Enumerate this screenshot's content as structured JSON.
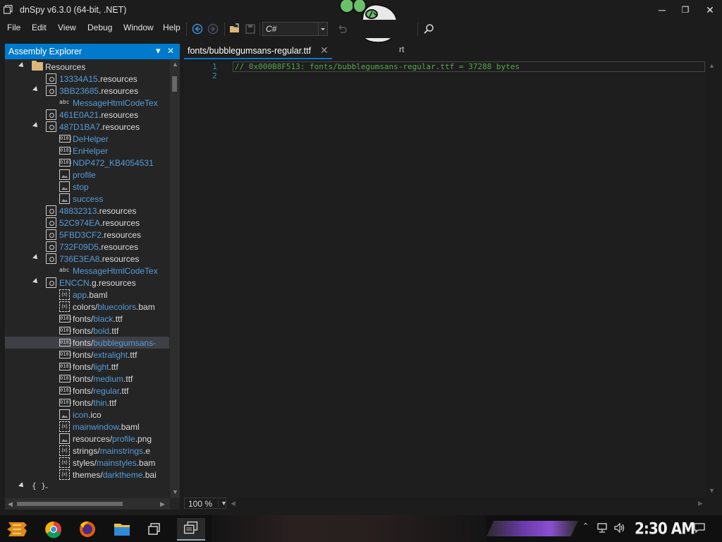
{
  "window": {
    "title": "dnSpy v6.3.0 (64-bit, .NET)",
    "minimize": "─",
    "restore": "❐",
    "close": "✕"
  },
  "menu": {
    "items": [
      "File",
      "Edit",
      "View",
      "Debug",
      "Window",
      "Help"
    ],
    "language": "C#",
    "start_fragment": "rt"
  },
  "explorer": {
    "title": "Assembly Explorer",
    "dropdown_glyph": "▾",
    "close_glyph": "✕",
    "rows": [
      {
        "indent": 0,
        "icon": "folder",
        "expander": true,
        "parts": [
          {
            "t": "Resources",
            "c": "white"
          }
        ]
      },
      {
        "indent": 1,
        "icon": "resource",
        "expander": false,
        "parts": [
          {
            "t": "13334A15",
            "c": "blue"
          },
          {
            "t": ".resources",
            "c": "white"
          }
        ]
      },
      {
        "indent": 1,
        "icon": "resource",
        "expander": true,
        "parts": [
          {
            "t": "3BB23685",
            "c": "blue"
          },
          {
            "t": ".resources",
            "c": "white"
          }
        ]
      },
      {
        "indent": 2,
        "icon": "abc",
        "expander": false,
        "parts": [
          {
            "t": "MessageHtmlCodeTex",
            "c": "blue"
          }
        ]
      },
      {
        "indent": 1,
        "icon": "resource",
        "expander": false,
        "parts": [
          {
            "t": "461E0A21",
            "c": "blue"
          },
          {
            "t": ".resources",
            "c": "white"
          }
        ]
      },
      {
        "indent": 1,
        "icon": "resource",
        "expander": true,
        "parts": [
          {
            "t": "487D1BA7",
            "c": "blue"
          },
          {
            "t": ".resources",
            "c": "white"
          }
        ]
      },
      {
        "indent": 2,
        "icon": "binary",
        "expander": false,
        "parts": [
          {
            "t": "DeHelper",
            "c": "blue"
          }
        ]
      },
      {
        "indent": 2,
        "icon": "binary",
        "expander": false,
        "parts": [
          {
            "t": "EnHelper",
            "c": "blue"
          }
        ]
      },
      {
        "indent": 2,
        "icon": "binary",
        "expander": false,
        "parts": [
          {
            "t": "NDP472_KB4054531",
            "c": "blue"
          }
        ]
      },
      {
        "indent": 2,
        "icon": "image",
        "expander": false,
        "parts": [
          {
            "t": "profile",
            "c": "blue"
          }
        ]
      },
      {
        "indent": 2,
        "icon": "image",
        "expander": false,
        "parts": [
          {
            "t": "stop",
            "c": "blue"
          }
        ]
      },
      {
        "indent": 2,
        "icon": "image",
        "expander": false,
        "parts": [
          {
            "t": "success",
            "c": "blue"
          }
        ]
      },
      {
        "indent": 1,
        "icon": "resource",
        "expander": false,
        "parts": [
          {
            "t": "48832313",
            "c": "blue"
          },
          {
            "t": ".resources",
            "c": "white"
          }
        ]
      },
      {
        "indent": 1,
        "icon": "resource",
        "expander": false,
        "parts": [
          {
            "t": "52C974EA",
            "c": "blue"
          },
          {
            "t": ".resources",
            "c": "white"
          }
        ]
      },
      {
        "indent": 1,
        "icon": "resource",
        "expander": false,
        "parts": [
          {
            "t": "5FBD3CF2",
            "c": "blue"
          },
          {
            "t": ".resources",
            "c": "white"
          }
        ]
      },
      {
        "indent": 1,
        "icon": "resource",
        "expander": false,
        "parts": [
          {
            "t": "732F09D5",
            "c": "blue"
          },
          {
            "t": ".resources",
            "c": "white"
          }
        ]
      },
      {
        "indent": 1,
        "icon": "resource",
        "expander": true,
        "parts": [
          {
            "t": "736E3EA8",
            "c": "blue"
          },
          {
            "t": ".resources",
            "c": "white"
          }
        ]
      },
      {
        "indent": 2,
        "icon": "abc",
        "expander": false,
        "parts": [
          {
            "t": "MessageHtmlCodeTex",
            "c": "blue"
          }
        ]
      },
      {
        "indent": 1,
        "icon": "resource",
        "expander": true,
        "parts": [
          {
            "t": "ENCCN",
            "c": "blue"
          },
          {
            "t": ".g.resources",
            "c": "white"
          }
        ]
      },
      {
        "indent": 2,
        "icon": "baml",
        "expander": false,
        "parts": [
          {
            "t": "app",
            "c": "blue"
          },
          {
            "t": ".baml",
            "c": "white"
          }
        ]
      },
      {
        "indent": 2,
        "icon": "baml",
        "expander": false,
        "parts": [
          {
            "t": "colors/",
            "c": "white"
          },
          {
            "t": "bluecolors",
            "c": "blue"
          },
          {
            "t": ".bam",
            "c": "white"
          }
        ]
      },
      {
        "indent": 2,
        "icon": "binary",
        "expander": false,
        "parts": [
          {
            "t": "fonts/",
            "c": "white"
          },
          {
            "t": "black",
            "c": "blue"
          },
          {
            "t": ".ttf",
            "c": "white"
          }
        ]
      },
      {
        "indent": 2,
        "icon": "binary",
        "expander": false,
        "parts": [
          {
            "t": "fonts/",
            "c": "white"
          },
          {
            "t": "bold",
            "c": "blue"
          },
          {
            "t": ".ttf",
            "c": "white"
          }
        ]
      },
      {
        "indent": 2,
        "icon": "binary",
        "expander": false,
        "selected": true,
        "parts": [
          {
            "t": "fonts/",
            "c": "white"
          },
          {
            "t": "bubblegumsans-",
            "c": "blue"
          }
        ]
      },
      {
        "indent": 2,
        "icon": "binary",
        "expander": false,
        "parts": [
          {
            "t": "fonts/",
            "c": "white"
          },
          {
            "t": "extralight",
            "c": "blue"
          },
          {
            "t": ".ttf",
            "c": "white"
          }
        ]
      },
      {
        "indent": 2,
        "icon": "binary",
        "expander": false,
        "parts": [
          {
            "t": "fonts/",
            "c": "white"
          },
          {
            "t": "light",
            "c": "blue"
          },
          {
            "t": ".ttf",
            "c": "white"
          }
        ]
      },
      {
        "indent": 2,
        "icon": "binary",
        "expander": false,
        "parts": [
          {
            "t": "fonts/",
            "c": "white"
          },
          {
            "t": "medium",
            "c": "blue"
          },
          {
            "t": ".ttf",
            "c": "white"
          }
        ]
      },
      {
        "indent": 2,
        "icon": "binary",
        "expander": false,
        "parts": [
          {
            "t": "fonts/",
            "c": "white"
          },
          {
            "t": "regular",
            "c": "blue"
          },
          {
            "t": ".ttf",
            "c": "white"
          }
        ]
      },
      {
        "indent": 2,
        "icon": "binary",
        "expander": false,
        "parts": [
          {
            "t": "fonts/",
            "c": "white"
          },
          {
            "t": "thin",
            "c": "blue"
          },
          {
            "t": ".ttf",
            "c": "white"
          }
        ]
      },
      {
        "indent": 2,
        "icon": "image",
        "expander": false,
        "parts": [
          {
            "t": "icon",
            "c": "blue"
          },
          {
            "t": ".ico",
            "c": "white"
          }
        ]
      },
      {
        "indent": 2,
        "icon": "baml",
        "expander": false,
        "parts": [
          {
            "t": "mainwindow",
            "c": "blue"
          },
          {
            "t": ".baml",
            "c": "white"
          }
        ]
      },
      {
        "indent": 2,
        "icon": "image",
        "expander": false,
        "parts": [
          {
            "t": "resources/",
            "c": "white"
          },
          {
            "t": "profile",
            "c": "blue"
          },
          {
            "t": ".png",
            "c": "white"
          }
        ]
      },
      {
        "indent": 2,
        "icon": "baml",
        "expander": false,
        "parts": [
          {
            "t": "strings/",
            "c": "white"
          },
          {
            "t": "mainstrings",
            "c": "blue"
          },
          {
            "t": ".e",
            "c": "white"
          }
        ]
      },
      {
        "indent": 2,
        "icon": "baml",
        "expander": false,
        "parts": [
          {
            "t": "styles/",
            "c": "white"
          },
          {
            "t": "mainstyles",
            "c": "blue"
          },
          {
            "t": ".bam",
            "c": "white"
          }
        ]
      },
      {
        "indent": 2,
        "icon": "baml",
        "expander": false,
        "parts": [
          {
            "t": "themes/",
            "c": "white"
          },
          {
            "t": "darktheme",
            "c": "blue"
          },
          {
            "t": ".bai",
            "c": "white"
          }
        ]
      },
      {
        "indent": -1,
        "icon": "namespace",
        "expander": true,
        "parts": [
          {
            "t": "-",
            "c": "white"
          }
        ]
      }
    ]
  },
  "editor": {
    "tab_label": "fonts/bubblegumsans-regular.ttf",
    "tab_close": "✕",
    "lines": [
      {
        "num": "1",
        "text": "// 0x000B8F513: fonts/bubblegumsans-regular.ttf = 37288 bytes"
      },
      {
        "num": "2",
        "text": ""
      }
    ],
    "zoom": "100 %"
  },
  "taskbar": {
    "clock": "2:30 AM"
  },
  "colors": {
    "accent": "#007acc",
    "type_blue": "#569cd6",
    "comment_green": "#57a64a",
    "line_number": "#2b91af"
  }
}
